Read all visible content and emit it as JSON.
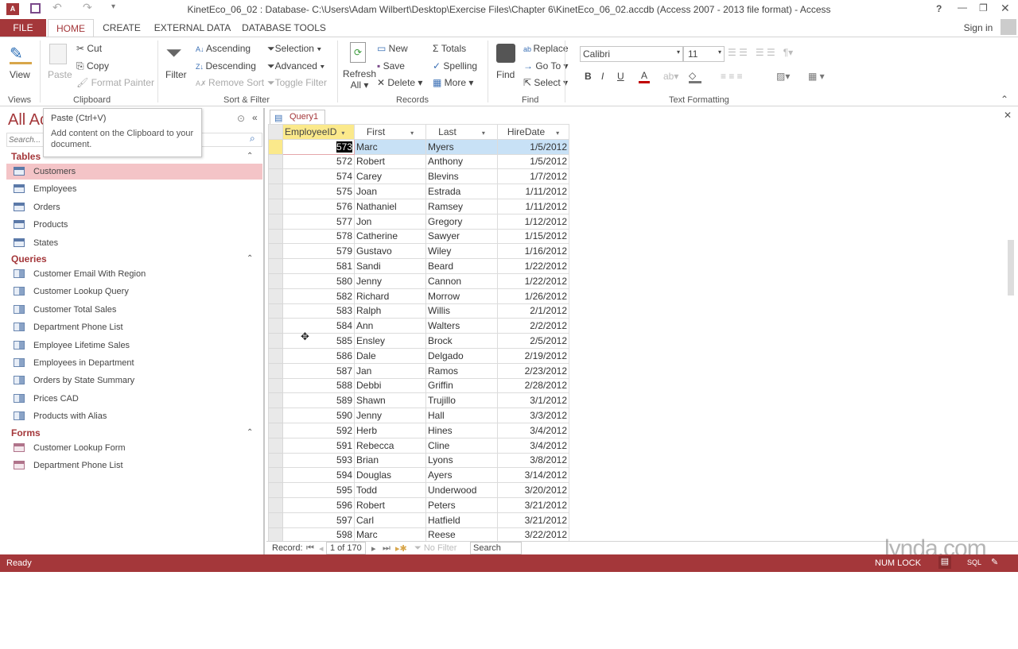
{
  "window": {
    "title": "KinetEco_06_02 : Database- C:\\Users\\Adam Wilbert\\Desktop\\Exercise Files\\Chapter 6\\KinetEco_06_02.accdb (Access 2007 - 2013 file format) - Access",
    "help": "?",
    "sign_in": "Sign in"
  },
  "tabs": [
    "FILE",
    "HOME",
    "CREATE",
    "EXTERNAL DATA",
    "DATABASE TOOLS"
  ],
  "ribbon": {
    "views": {
      "view": "View",
      "group": "Views"
    },
    "clipboard": {
      "paste": "Paste",
      "cut": "Cut",
      "copy": "Copy",
      "format_painter": "Format Painter",
      "group": "Clipboard"
    },
    "sort_filter": {
      "filter": "Filter",
      "ascending": "Ascending",
      "descending": "Descending",
      "remove_sort": "Remove Sort",
      "selection": "Selection",
      "advanced": "Advanced",
      "toggle_filter": "Toggle Filter",
      "group": "Sort & Filter"
    },
    "records": {
      "refresh": "Refresh",
      "refresh_all": "All",
      "new": "New",
      "save": "Save",
      "delete": "Delete",
      "totals": "Totals",
      "spelling": "Spelling",
      "more": "More",
      "group": "Records"
    },
    "find": {
      "find": "Find",
      "replace": "Replace",
      "goto": "Go To",
      "select": "Select",
      "group": "Find"
    },
    "text_formatting": {
      "font": "Calibri",
      "size": "11",
      "bold": "B",
      "italic": "I",
      "underline": "U",
      "group": "Text Formatting"
    }
  },
  "tooltip": {
    "title": "Paste (Ctrl+V)",
    "body": "Add content on the Clipboard to your document."
  },
  "nav": {
    "title": "All Access Objects",
    "search_placeholder": "Search...",
    "sections": [
      {
        "label": "Tables",
        "items": [
          "Customers",
          "Employees",
          "Orders",
          "Products",
          "States"
        ]
      },
      {
        "label": "Queries",
        "items": [
          "Customer Email With Region",
          "Customer Lookup Query",
          "Customer Total Sales",
          "Department Phone List",
          "Employee Lifetime Sales",
          "Employees in Department",
          "Orders by State Summary",
          "Prices CAD",
          "Products with Alias"
        ]
      },
      {
        "label": "Forms",
        "items": [
          "Customer Lookup Form",
          "Department Phone List"
        ]
      }
    ]
  },
  "query_tab": "Query1",
  "columns": [
    "EmployeeID",
    "First",
    "Last",
    "HireDate"
  ],
  "rows": [
    [
      "573",
      "Marc",
      "Myers",
      "1/5/2012"
    ],
    [
      "572",
      "Robert",
      "Anthony",
      "1/5/2012"
    ],
    [
      "574",
      "Carey",
      "Blevins",
      "1/7/2012"
    ],
    [
      "575",
      "Joan",
      "Estrada",
      "1/11/2012"
    ],
    [
      "576",
      "Nathaniel",
      "Ramsey",
      "1/11/2012"
    ],
    [
      "577",
      "Jon",
      "Gregory",
      "1/12/2012"
    ],
    [
      "578",
      "Catherine",
      "Sawyer",
      "1/15/2012"
    ],
    [
      "579",
      "Gustavo",
      "Wiley",
      "1/16/2012"
    ],
    [
      "581",
      "Sandi",
      "Beard",
      "1/22/2012"
    ],
    [
      "580",
      "Jenny",
      "Cannon",
      "1/22/2012"
    ],
    [
      "582",
      "Richard",
      "Morrow",
      "1/26/2012"
    ],
    [
      "583",
      "Ralph",
      "Willis",
      "2/1/2012"
    ],
    [
      "584",
      "Ann",
      "Walters",
      "2/2/2012"
    ],
    [
      "585",
      "Ensley",
      "Brock",
      "2/5/2012"
    ],
    [
      "586",
      "Dale",
      "Delgado",
      "2/19/2012"
    ],
    [
      "587",
      "Jan",
      "Ramos",
      "2/23/2012"
    ],
    [
      "588",
      "Debbi",
      "Griffin",
      "2/28/2012"
    ],
    [
      "589",
      "Shawn",
      "Trujillo",
      "3/1/2012"
    ],
    [
      "590",
      "Jenny",
      "Hall",
      "3/3/2012"
    ],
    [
      "592",
      "Herb",
      "Hines",
      "3/4/2012"
    ],
    [
      "591",
      "Rebecca",
      "Cline",
      "3/4/2012"
    ],
    [
      "593",
      "Brian",
      "Lyons",
      "3/8/2012"
    ],
    [
      "594",
      "Douglas",
      "Ayers",
      "3/14/2012"
    ],
    [
      "595",
      "Todd",
      "Underwood",
      "3/20/2012"
    ],
    [
      "596",
      "Robert",
      "Peters",
      "3/21/2012"
    ],
    [
      "597",
      "Carl",
      "Hatfield",
      "3/21/2012"
    ],
    [
      "598",
      "Marc",
      "Reese",
      "3/22/2012"
    ]
  ],
  "record_nav": {
    "label": "Record:",
    "position": "1 of 170",
    "filter": "No Filter",
    "search": "Search"
  },
  "status": {
    "text": "Ready",
    "num_lock": "NUM LOCK",
    "sql": "SQL"
  },
  "watermark": "lynda.com",
  "colors": {
    "accent": "#a4373a",
    "selected_nav": "#f4c4c7",
    "current_row": "#c8e1f6",
    "selector": "#fbe98b"
  }
}
